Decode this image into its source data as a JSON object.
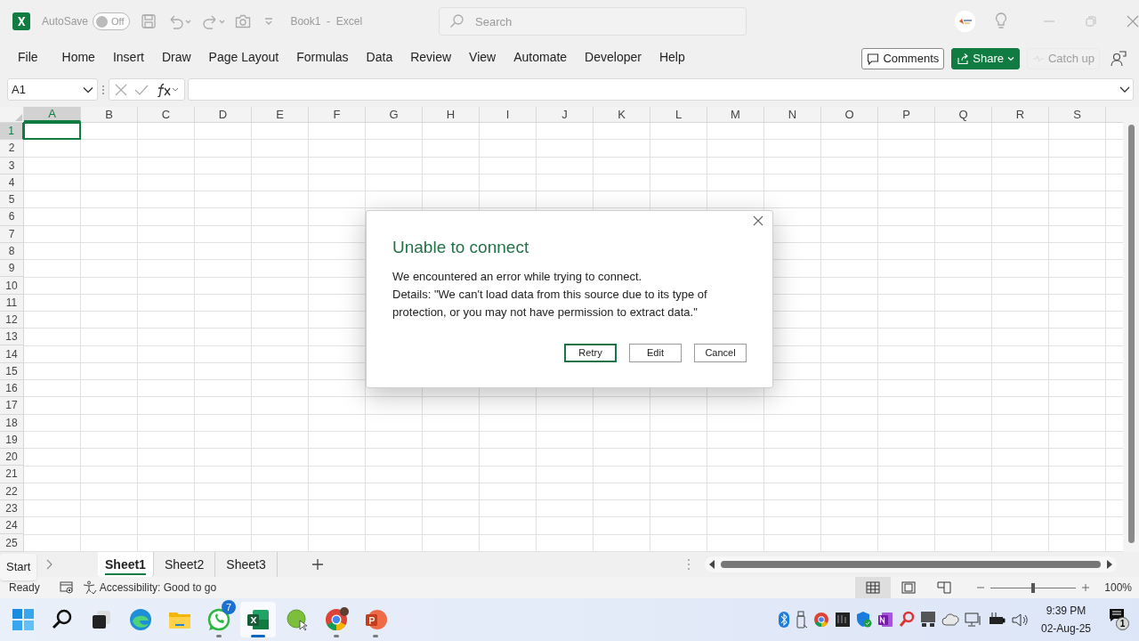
{
  "title_bar": {
    "autosave_label": "AutoSave",
    "autosave_toggle": {
      "label": "Off",
      "on": false
    },
    "document_title": "Book1  -  Excel",
    "search": {
      "placeholder": "Search"
    }
  },
  "ribbon_tabs": [
    {
      "label": "File",
      "selected": false
    },
    {
      "label": "Home",
      "selected": false
    },
    {
      "label": "Insert",
      "selected": false
    },
    {
      "label": "Draw",
      "selected": false
    },
    {
      "label": "Page Layout",
      "selected": false
    },
    {
      "label": "Formulas",
      "selected": false
    },
    {
      "label": "Data",
      "selected": false
    },
    {
      "label": "Review",
      "selected": false
    },
    {
      "label": "View",
      "selected": false
    },
    {
      "label": "Automate",
      "selected": false
    },
    {
      "label": "Developer",
      "selected": false
    },
    {
      "label": "Help",
      "selected": false
    }
  ],
  "ribbon_buttons": [
    {
      "kind": "comments",
      "label": "Comments",
      "disabled": false
    },
    {
      "kind": "share",
      "label": "Share",
      "disabled": false
    },
    {
      "kind": "catchup",
      "label": "Catch up",
      "disabled": true
    }
  ],
  "formula_bar": {
    "name_box": "A1"
  },
  "grid": {
    "columns": [
      {
        "label": "A",
        "selected": true
      },
      {
        "label": "B",
        "selected": false
      },
      {
        "label": "C",
        "selected": false
      },
      {
        "label": "D",
        "selected": false
      },
      {
        "label": "E",
        "selected": false
      },
      {
        "label": "F",
        "selected": false
      },
      {
        "label": "G",
        "selected": false
      },
      {
        "label": "H",
        "selected": false
      },
      {
        "label": "I",
        "selected": false
      },
      {
        "label": "J",
        "selected": false
      },
      {
        "label": "K",
        "selected": false
      },
      {
        "label": "L",
        "selected": false
      },
      {
        "label": "M",
        "selected": false
      },
      {
        "label": "N",
        "selected": false
      },
      {
        "label": "O",
        "selected": false
      },
      {
        "label": "P",
        "selected": false
      },
      {
        "label": "Q",
        "selected": false
      },
      {
        "label": "R",
        "selected": false
      },
      {
        "label": "S",
        "selected": false
      }
    ],
    "rows": [
      {
        "label": "1",
        "selected": true
      },
      {
        "label": "2",
        "selected": false
      },
      {
        "label": "3",
        "selected": false
      },
      {
        "label": "4",
        "selected": false
      },
      {
        "label": "5",
        "selected": false
      },
      {
        "label": "6",
        "selected": false
      },
      {
        "label": "7",
        "selected": false
      },
      {
        "label": "8",
        "selected": false
      },
      {
        "label": "9",
        "selected": false
      },
      {
        "label": "10",
        "selected": false
      },
      {
        "label": "11",
        "selected": false
      },
      {
        "label": "12",
        "selected": false
      },
      {
        "label": "13",
        "selected": false
      },
      {
        "label": "14",
        "selected": false
      },
      {
        "label": "15",
        "selected": false
      },
      {
        "label": "16",
        "selected": false
      },
      {
        "label": "17",
        "selected": false
      },
      {
        "label": "18",
        "selected": false
      },
      {
        "label": "19",
        "selected": false
      },
      {
        "label": "20",
        "selected": false
      },
      {
        "label": "21",
        "selected": false
      },
      {
        "label": "22",
        "selected": false
      },
      {
        "label": "23",
        "selected": false
      },
      {
        "label": "24",
        "selected": false
      },
      {
        "label": "25",
        "selected": false
      }
    ]
  },
  "dialog": {
    "title": "Unable to connect",
    "message": "We encountered an error while trying to connect.",
    "details": "Details: \"We can't load data from this source due to its type of protection, or you may not have permission to extract data.\"",
    "buttons": [
      {
        "label": "Retry",
        "default": true
      },
      {
        "label": "Edit",
        "default": false
      },
      {
        "label": "Cancel",
        "default": false
      }
    ]
  },
  "sheet_tabs": [
    {
      "label": "Sheet1",
      "selected": true
    },
    {
      "label": "Sheet2",
      "selected": false
    },
    {
      "label": "Sheet3",
      "selected": false
    }
  ],
  "tooltip": "Start",
  "status_bar": {
    "ready": "Ready",
    "accessibility": "Accessibility: Good to go",
    "views": [
      {
        "kind": "normal",
        "selected": true
      },
      {
        "kind": "page_layout",
        "selected": false
      },
      {
        "kind": "page_break",
        "selected": false
      }
    ],
    "zoom": {
      "level": 0.5
    },
    "zoom_label": "100%"
  },
  "taskbar": {
    "apps": [
      {
        "kind": "start",
        "running": false,
        "active": false
      },
      {
        "kind": "search",
        "running": false,
        "active": false
      },
      {
        "kind": "taskview",
        "running": false,
        "active": false
      },
      {
        "kind": "edge",
        "running": false,
        "active": false
      },
      {
        "kind": "folder",
        "running": false,
        "active": false
      },
      {
        "kind": "whatsapp",
        "running": true,
        "active": false,
        "badge": "7"
      },
      {
        "kind": "excel",
        "running": true,
        "active": true
      },
      {
        "kind": "green",
        "running": false,
        "active": false
      },
      {
        "kind": "chrome",
        "running": true,
        "active": false
      },
      {
        "kind": "powerpoint",
        "running": true,
        "active": false
      }
    ],
    "time": "9:39 PM",
    "date": "02-Aug-25",
    "notification_count": "1"
  }
}
